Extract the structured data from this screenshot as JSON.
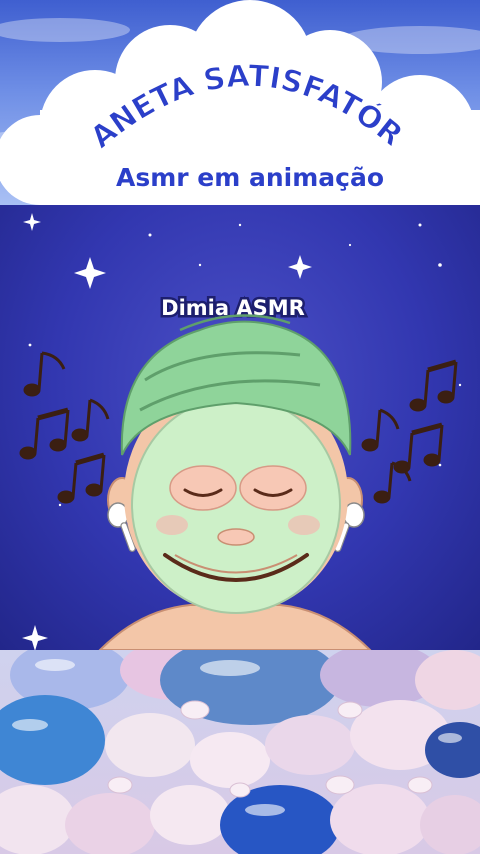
{
  "header": {
    "title": "PLANETA SATISFATÓRIO",
    "subtitle": "Asmr em animação"
  },
  "video": {
    "channel_label": "Dimia ASMR"
  },
  "colors": {
    "title_blue": "#2b3fc9",
    "title_outline": "#ffffff",
    "scene_bg": "#3237b0",
    "towel_green": "#8fd49a",
    "mask_green": "#cdf0c8",
    "skin": "#f3c6a8"
  },
  "icons": [
    "music-note-icon",
    "sparkle-icon",
    "earbud-icon"
  ]
}
